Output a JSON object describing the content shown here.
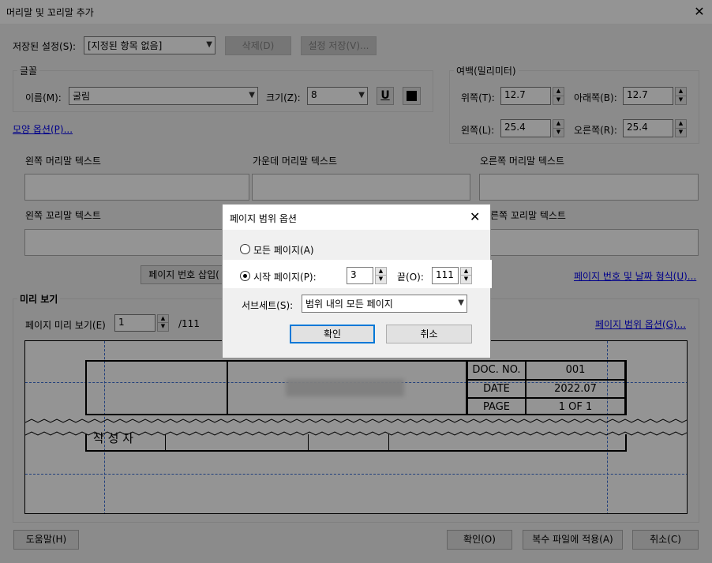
{
  "window": {
    "title": "머리말 및 꼬리말 추가"
  },
  "saved": {
    "label": "저장된 설정(S):",
    "value": "[지정된 항목 없음]",
    "delete": "삭제(D)",
    "save": "설정 저장(V)..."
  },
  "font": {
    "group": "글꼴",
    "name_label": "이름(M):",
    "name_value": "굴림",
    "size_label": "크기(Z):",
    "size_value": "8"
  },
  "margin": {
    "group": "여백(밀리미터)",
    "top_label": "위쪽(T):",
    "top_value": "12.7",
    "bottom_label": "아래쪽(B):",
    "bottom_value": "12.7",
    "left_label": "왼쪽(L):",
    "left_value": "25.4",
    "right_label": "오른쪽(R):",
    "right_value": "25.4"
  },
  "appearance_link": "모양 옵션(P)...",
  "header": {
    "left": "왼쪽 머리말 텍스트",
    "center": "가운데 머리말 텍스트",
    "right": "오른쪽 머리말 텍스트"
  },
  "footer": {
    "left": "왼쪽 꼬리말 텍스트",
    "right": "른쪽 꼬리말 텍스트"
  },
  "insert_page_btn": "페이지 번호 삽입(",
  "format_link": "페이지 번호 및 날짜 형식(U)...",
  "preview": {
    "group": "미리 보기",
    "page_label": "페이지 미리 보기(E)",
    "page_value": "1",
    "total": "/111",
    "range_link": "페이지 범위 옵션(G)...",
    "doc_no_label": "DOC. NO.",
    "doc_no_value": "001",
    "date_label": "DATE",
    "date_value": "2022.07",
    "page_label2": "PAGE",
    "page_value2": "1 OF 1",
    "author": "작 성 자"
  },
  "bottom": {
    "help": "도움말(H)",
    "ok": "확인(O)",
    "apply_multi": "복수 파일에 적용(A)",
    "cancel": "취소(C)"
  },
  "modal": {
    "title": "페이지 범위 옵션",
    "all_pages": "모든 페이지(A)",
    "start_page": "시작 페이지(P):",
    "start_value": "3",
    "end_label": "끝(O):",
    "end_value": "111",
    "subset_label": "서브세트(S):",
    "subset_value": "범위 내의 모든 페이지",
    "ok": "확인",
    "cancel": "취소"
  }
}
